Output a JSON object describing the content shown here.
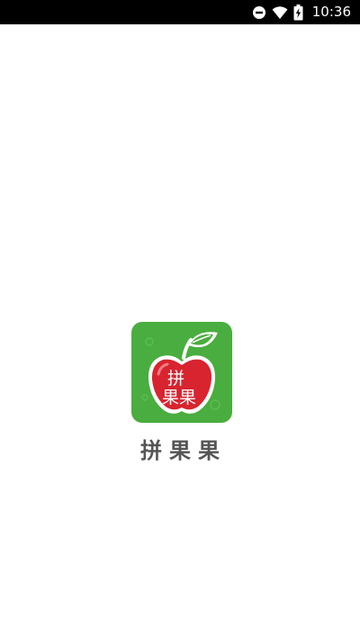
{
  "status_bar": {
    "time": "10:36",
    "icons": [
      "do-not-disturb-icon",
      "wifi-icon",
      "battery-charging-icon"
    ]
  },
  "splash": {
    "app_name": "拼果果",
    "icon_text_top": "拼",
    "icon_text_bottom": "果果",
    "colors": {
      "icon_background": "#4aad3f",
      "apple": "#d8242f",
      "leaf": "#4aad3f",
      "app_name": "#555555"
    }
  }
}
